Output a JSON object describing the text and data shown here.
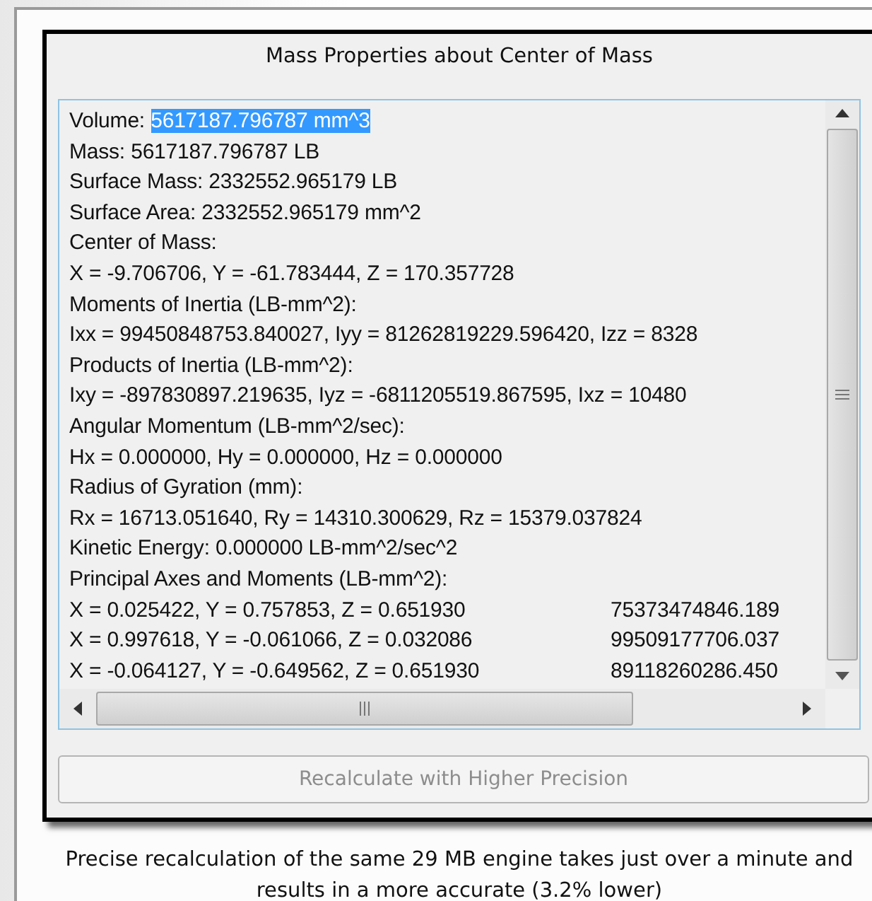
{
  "dialog": {
    "title": "Mass Properties about Center of Mass"
  },
  "results": [
    {
      "kind": "field",
      "label": "Volume:",
      "value": "5617187.796787 mm^3",
      "selected": true
    },
    {
      "kind": "plain",
      "text": "Mass: 5617187.796787 LB"
    },
    {
      "kind": "plain",
      "text": "Surface Mass: 2332552.965179 LB"
    },
    {
      "kind": "plain",
      "text": "Surface Area: 2332552.965179 mm^2"
    },
    {
      "kind": "plain",
      "text": "Center of Mass:"
    },
    {
      "kind": "plain",
      "text": "X = -9.706706, Y = -61.783444, Z = 170.357728"
    },
    {
      "kind": "plain",
      "text": "Moments of Inertia (LB-mm^2):"
    },
    {
      "kind": "plain",
      "text": "Ixx = 99450848753.840027, Iyy = 81262819229.596420, Izz = 8328"
    },
    {
      "kind": "plain",
      "text": "Products of Inertia (LB-mm^2):"
    },
    {
      "kind": "plain",
      "text": "Ixy = -897830897.219635, Iyz = -6811205519.867595, Ixz = 10480"
    },
    {
      "kind": "plain",
      "text": "Angular Momentum (LB-mm^2/sec):"
    },
    {
      "kind": "plain",
      "text": "Hx = 0.000000, Hy = 0.000000, Hz = 0.000000"
    },
    {
      "kind": "plain",
      "text": "Radius of Gyration (mm):"
    },
    {
      "kind": "plain",
      "text": "Rx = 16713.051640, Ry = 14310.300629, Rz = 15379.037824"
    },
    {
      "kind": "plain",
      "text": "Kinetic Energy: 0.000000 LB-mm^2/sec^2"
    },
    {
      "kind": "plain",
      "text": "Principal Axes and Moments (LB-mm^2):"
    },
    {
      "kind": "axis",
      "text": "X = 0.025422, Y = 0.757853, Z = 0.651930",
      "moment": "75373474846.189"
    },
    {
      "kind": "axis",
      "text": "X = 0.997618, Y = -0.061066, Z = 0.032086",
      "moment": "99509177706.037"
    },
    {
      "kind": "axis",
      "text": "X = -0.064127, Y = -0.649562, Z = 0.651930",
      "moment": "89118260286.450"
    }
  ],
  "recalculate_button": {
    "label": "Recalculate with Higher Precision",
    "disabled": true
  },
  "caption": "Precise recalculation of the same 29 MB engine takes just over a minute and results in a more accurate (3.2% lower)"
}
